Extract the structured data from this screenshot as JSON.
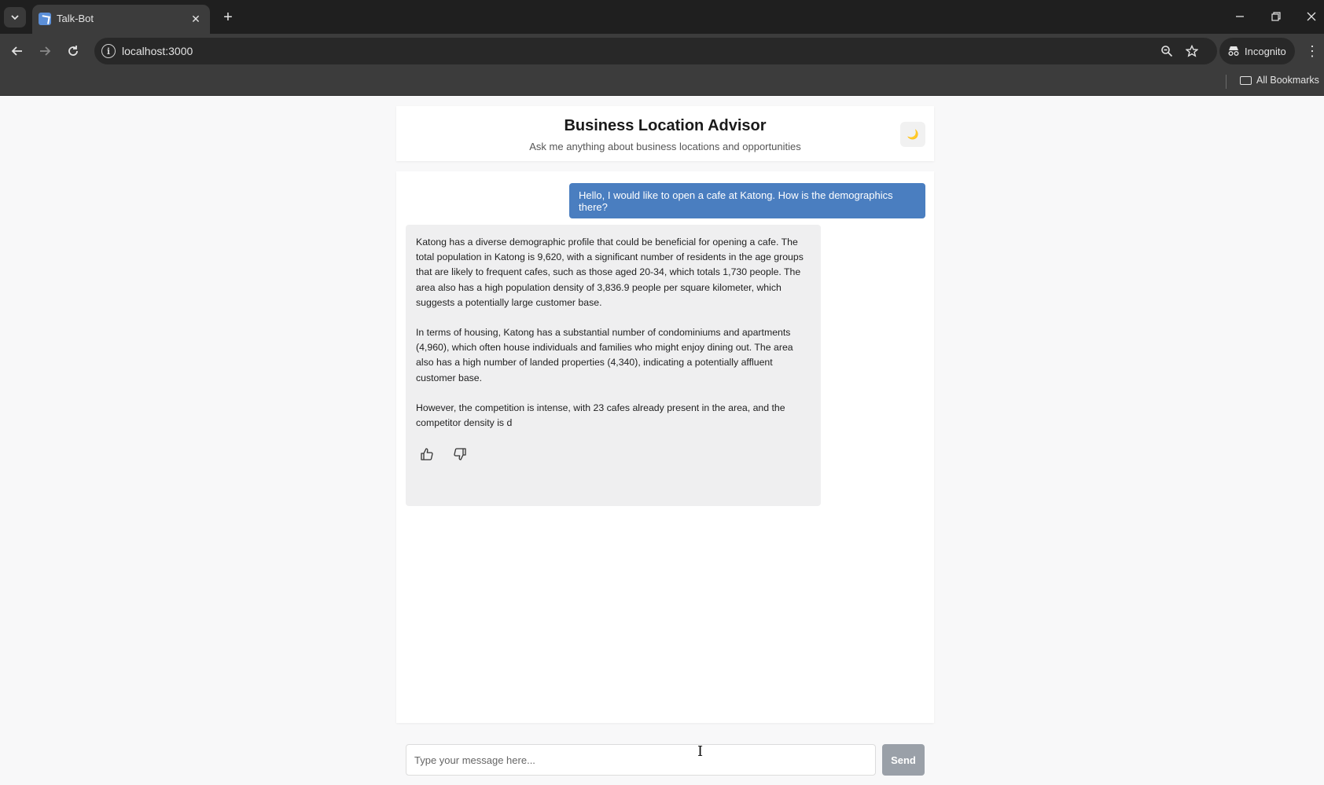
{
  "browser": {
    "tab_title": "Talk-Bot",
    "url": "localhost:3000",
    "incognito_label": "Incognito",
    "all_bookmarks_label": "All Bookmarks"
  },
  "app": {
    "title": "Business Location Advisor",
    "subtitle": "Ask me anything about business locations and opportunities",
    "theme_icon": "moon-icon"
  },
  "chat": {
    "user_message": "Hello, I would like to open a cafe at Katong. How is the demographics there?",
    "bot_paragraphs": [
      "Katong has a diverse demographic profile that could be beneficial for opening a cafe. The total population in Katong is 9,620, with a significant number of residents in the age groups that are likely to frequent cafes, such as those aged 20-34, which totals 1,730 people. The area also has a high population density of 3,836.9 people per square kilometer, which suggests a potentially large customer base.",
      "In terms of housing, Katong has a substantial number of condominiums and apartments (4,960), which often house individuals and families who might enjoy dining out. The area also has a high number of landed properties (4,340), indicating a potentially affluent customer base.",
      "However, the competition is intense, with 23 cafes already present in the area, and the competitor density is d"
    ]
  },
  "input": {
    "placeholder": "Type your message here...",
    "send_label": "Send"
  },
  "colors": {
    "user_bubble": "#4a7ec0",
    "bot_bubble": "#efeff0",
    "send_button": "#9aa0a8"
  }
}
